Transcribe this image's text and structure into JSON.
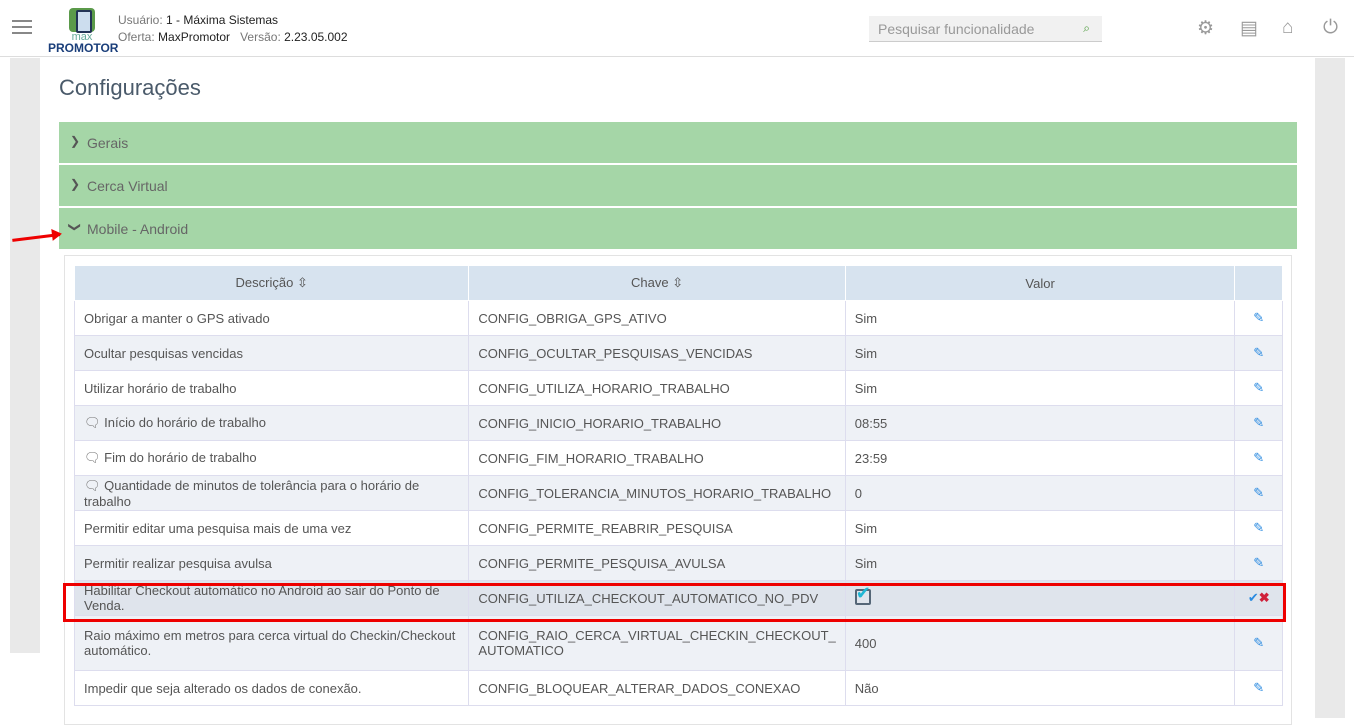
{
  "header": {
    "user_label": "Usuário:",
    "user": "1 - Máxima Sistemas",
    "offer_label": "Oferta:",
    "offer": "MaxPromotor",
    "version_label": "Versão:",
    "version": "2.23.05.002",
    "logo_top": "max",
    "logo_bottom": "PROMOTOR",
    "search_placeholder": "Pesquisar funcionalidade"
  },
  "page": {
    "title": "Configurações"
  },
  "sections": [
    {
      "label": "Gerais"
    },
    {
      "label": "Cerca Virtual"
    },
    {
      "label": "Mobile - Android"
    }
  ],
  "table": {
    "headers": [
      "Descrição",
      "Chave",
      "Valor"
    ],
    "rows": [
      {
        "desc": "Obrigar a manter o GPS ativado",
        "key": "CONFIG_OBRIGA_GPS_ATIVO",
        "value": "Sim"
      },
      {
        "desc": "Ocultar pesquisas vencidas",
        "key": "CONFIG_OCULTAR_PESQUISAS_VENCIDAS",
        "value": "Sim"
      },
      {
        "desc": "Utilizar horário de trabalho",
        "key": "CONFIG_UTILIZA_HORARIO_TRABALHO",
        "value": "Sim"
      },
      {
        "desc": "Início do horário de trabalho",
        "key": "CONFIG_INICIO_HORARIO_TRABALHO",
        "value": "08:55",
        "comment": true
      },
      {
        "desc": "Fim do horário de trabalho",
        "key": "CONFIG_FIM_HORARIO_TRABALHO",
        "value": "23:59",
        "comment": true
      },
      {
        "desc": "Quantidade de minutos de tolerância para o horário de trabalho",
        "key": "CONFIG_TOLERANCIA_MINUTOS_HORARIO_TRABALHO",
        "value": "0",
        "comment": true
      },
      {
        "desc": "Permitir editar uma pesquisa mais de uma vez",
        "key": "CONFIG_PERMITE_REABRIR_PESQUISA",
        "value": "Sim"
      },
      {
        "desc": "Permitir realizar pesquisa avulsa",
        "key": "CONFIG_PERMITE_PESQUISA_AVULSA",
        "value": "Sim"
      },
      {
        "desc": "Habilitar Checkout automático no Android ao sair do Ponto de Venda.",
        "key": "CONFIG_UTILIZA_CHECKOUT_AUTOMATICO_NO_PDV",
        "value": "",
        "editing": true
      },
      {
        "desc": "Raio máximo em metros para cerca virtual do Checkin/Checkout automático.",
        "key": "CONFIG_RAIO_CERCA_VIRTUAL_CHECKIN_CHECKOUT_ AUTOMATICO",
        "value": "400"
      },
      {
        "desc": "Impedir que seja alterado os dados de conexão.",
        "key": "CONFIG_BLOQUEAR_ALTERAR_DADOS_CONEXAO",
        "value": "Não"
      }
    ]
  }
}
